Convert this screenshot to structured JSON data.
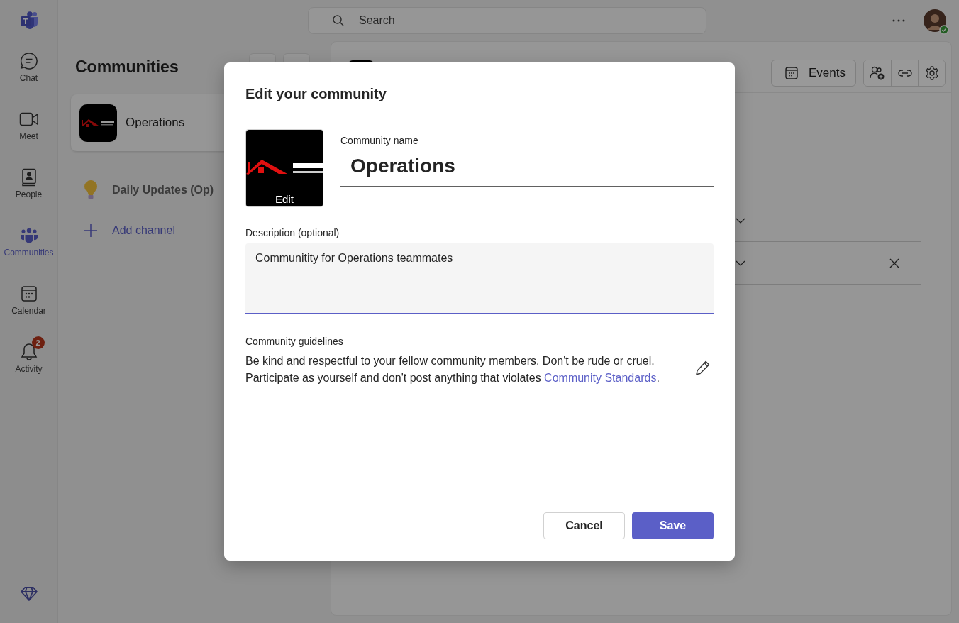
{
  "app_rail": {
    "items": [
      {
        "kind": "chat",
        "label": "Chat",
        "selected": false
      },
      {
        "kind": "meet",
        "label": "Meet",
        "selected": false
      },
      {
        "kind": "people",
        "label": "People",
        "selected": false
      },
      {
        "kind": "communities",
        "label": "Communities",
        "selected": true
      },
      {
        "kind": "calendar",
        "label": "Calendar",
        "selected": false
      },
      {
        "kind": "activity",
        "label": "Activity",
        "selected": false,
        "badge": "2"
      }
    ]
  },
  "search": {
    "placeholder": "Search"
  },
  "left_panel": {
    "title": "Communities",
    "communities": [
      {
        "name": "Operations",
        "selected": true
      }
    ],
    "channels": [
      {
        "name": "Daily Updates (Op)"
      }
    ],
    "add_channel": "Add channel"
  },
  "main_panel": {
    "events_button": "Events"
  },
  "dialog": {
    "title": "Edit your community",
    "image_edit_label": "Edit",
    "name_label": "Community name",
    "name_value": "Operations",
    "description_label": "Description (optional)",
    "description_value": "Communitity for Operations teammates",
    "guidelines_label": "Community guidelines",
    "guidelines_text": "Be kind and respectful to your fellow community members. Don't be rude or cruel. Participate as yourself and don't post anything that violates ",
    "guidelines_link": "Community Standards",
    "guidelines_end": ".",
    "buttons": [
      {
        "kind": "secondary",
        "label": "Cancel"
      },
      {
        "kind": "primary",
        "label": "Save"
      }
    ]
  }
}
